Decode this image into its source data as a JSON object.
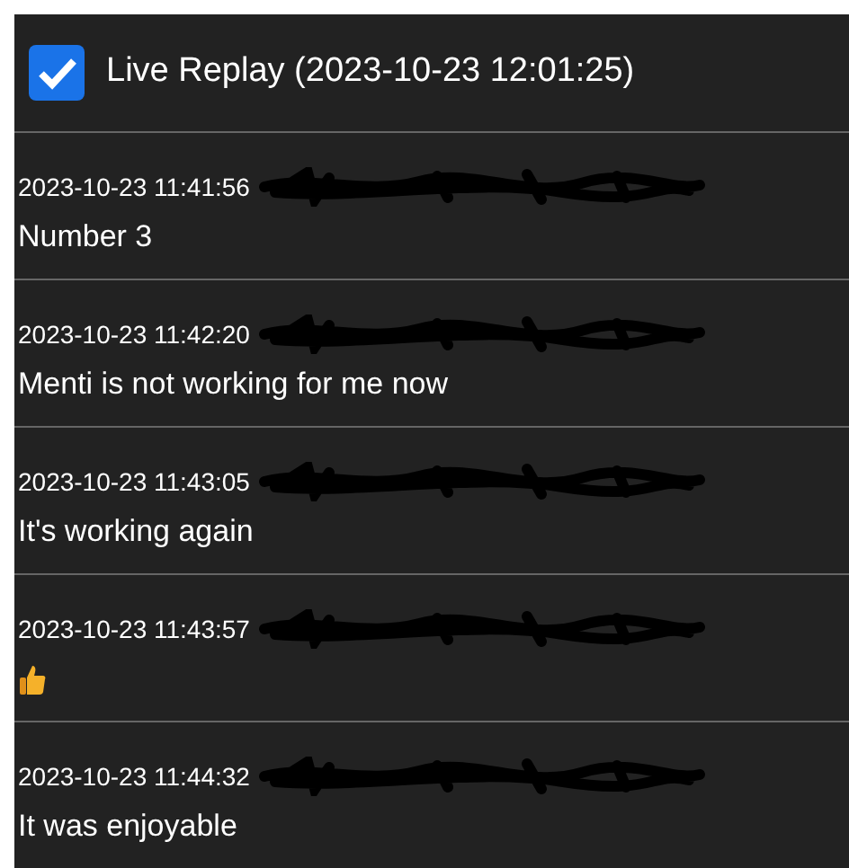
{
  "header": {
    "live_replay": {
      "checked": true,
      "label": "Live Replay (2023-10-23 12:01:25)"
    }
  },
  "messages": [
    {
      "time": "2023-10-23 11:41:56",
      "kind": "text",
      "text": "Number 3"
    },
    {
      "time": "2023-10-23 11:42:20",
      "kind": "text",
      "text": "Menti is not working for me now"
    },
    {
      "time": "2023-10-23 11:43:05",
      "kind": "text",
      "text": "It's working again"
    },
    {
      "time": "2023-10-23 11:43:57",
      "kind": "thumbs_up"
    },
    {
      "time": "2023-10-23 11:44:32",
      "kind": "text",
      "text": "It was enjoyable"
    }
  ]
}
